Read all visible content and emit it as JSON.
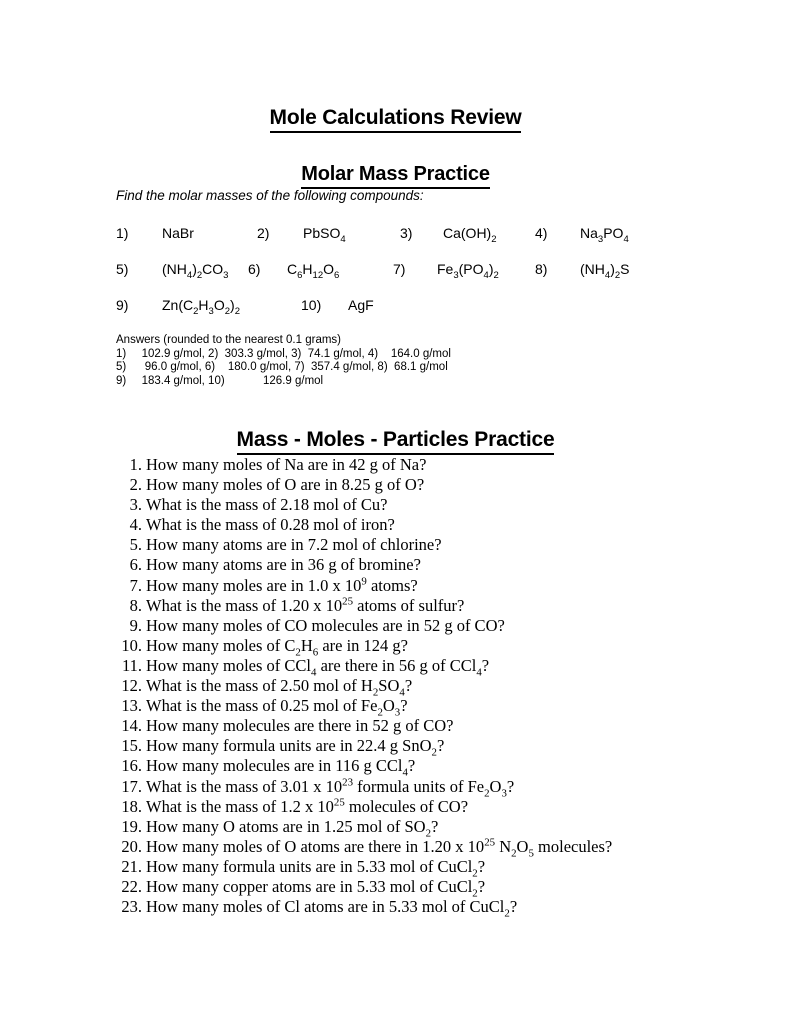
{
  "document": {
    "title": "Mole Calculations Review"
  },
  "section1": {
    "heading": "Molar Mass Practice",
    "instruction": "Find the molar masses of the following compounds:",
    "compound_rows": [
      [
        {
          "num": "1)",
          "formula_html": "NaBr"
        },
        {
          "num": "2)",
          "formula_html": "PbSO<sub>4</sub>"
        },
        {
          "num": "3)",
          "formula_html": "Ca(OH)<sub>2</sub>"
        },
        {
          "num": "4)",
          "formula_html": "Na<sub>3</sub>PO<sub>4</sub>"
        }
      ],
      [
        {
          "num": "5)",
          "formula_html": "(NH<sub>4</sub>)<sub>2</sub>CO<sub>3</sub>"
        },
        {
          "num": "6)",
          "formula_html": "C<sub>6</sub>H<sub>12</sub>O<sub>6</sub>"
        },
        {
          "num": "7)",
          "formula_html": "Fe<sub>3</sub>(PO<sub>4</sub>)<sub>2</sub>"
        },
        {
          "num": "8)",
          "formula_html": "(NH<sub>4</sub>)<sub>2</sub>S"
        }
      ],
      [
        {
          "num": "9)",
          "formula_html": "Zn(C<sub>2</sub>H<sub>3</sub>O<sub>2</sub>)<sub>2</sub>"
        },
        {
          "num": "10)",
          "formula_html": "AgF"
        }
      ]
    ],
    "answers": {
      "header": "Answers (rounded to the nearest 0.1 grams)",
      "lines": [
        "1)\t102.9 g/mol, 2)  303.3 g/mol, 3)  74.1 g/mol, 4)    164.0 g/mol",
        "5)\t 96.0 g/mol, 6)    180.0 g/mol, 7)  357.4 g/mol, 8)  68.1 g/mol",
        "9)\t183.4 g/mol, 10)            126.9 g/mol"
      ]
    }
  },
  "section2": {
    "heading": "Mass - Moles - Particles Practice",
    "questions": [
      {
        "num": "1.",
        "text_html": "How many moles of Na are in 42 g of Na?"
      },
      {
        "num": "2.",
        "text_html": "How many moles of O are in 8.25 g of O?"
      },
      {
        "num": "3.",
        "text_html": "What is the mass of 2.18 mol of Cu?"
      },
      {
        "num": "4.",
        "text_html": "What is the mass of 0.28 mol of iron?"
      },
      {
        "num": "5.",
        "text_html": "How many atoms are in 7.2 mol of chlorine?"
      },
      {
        "num": "6.",
        "text_html": "How many atoms are in 36 g of bromine?"
      },
      {
        "num": "7.",
        "text_html": "How many moles are in 1.0 x 10<sup>9</sup> atoms?"
      },
      {
        "num": "8.",
        "text_html": "What is the mass of 1.20 x 10<sup>25</sup> atoms of sulfur?"
      },
      {
        "num": "9.",
        "text_html": "How many moles of CO molecules are in 52 g of CO?"
      },
      {
        "num": "10.",
        "text_html": "How many moles of C<sub>2</sub>H<sub>6</sub> are in 124 g?"
      },
      {
        "num": "11.",
        "text_html": "How many moles of CCl<sub>4</sub> are there in 56 g of CCl<sub>4</sub>?"
      },
      {
        "num": "12.",
        "text_html": "What is the mass of 2.50 mol of H<sub>2</sub>SO<sub>4</sub>?"
      },
      {
        "num": "13.",
        "text_html": "What is the mass of 0.25 mol of Fe<sub>2</sub>O<sub>3</sub>?"
      },
      {
        "num": "14.",
        "text_html": "How many molecules are there in 52 g of CO?"
      },
      {
        "num": "15.",
        "text_html": "How many formula units are in 22.4 g SnO<sub>2</sub>?"
      },
      {
        "num": "16.",
        "text_html": "How many molecules are in 116 g CCl<sub>4</sub>?"
      },
      {
        "num": "17.",
        "text_html": "What is the mass of 3.01 x 10<sup>23</sup> formula units of Fe<sub>2</sub>O<sub>3</sub>?"
      },
      {
        "num": "18.",
        "text_html": "What is the mass of 1.2 x 10<sup>25</sup> molecules of CO?"
      },
      {
        "num": "19.",
        "text_html": "How many O atoms are in 1.25 mol of SO<sub>2</sub>?"
      },
      {
        "num": "20.",
        "text_html": "How many moles of O atoms are there in 1.20 x 10<sup>25</sup> N<sub>2</sub>O<sub>5</sub> molecules?"
      },
      {
        "num": "21.",
        "text_html": "How many formula units are in 5.33 mol of CuCl<sub>2</sub>?"
      },
      {
        "num": "22.",
        "text_html": "How many copper atoms are in 5.33 mol of CuCl<sub>2</sub>?"
      },
      {
        "num": "23.",
        "text_html": "How many moles of Cl atoms are in 5.33 mol of CuCl<sub>2</sub>?"
      }
    ]
  },
  "colors": {
    "page_background": "#ffffff",
    "text": "#000000"
  }
}
